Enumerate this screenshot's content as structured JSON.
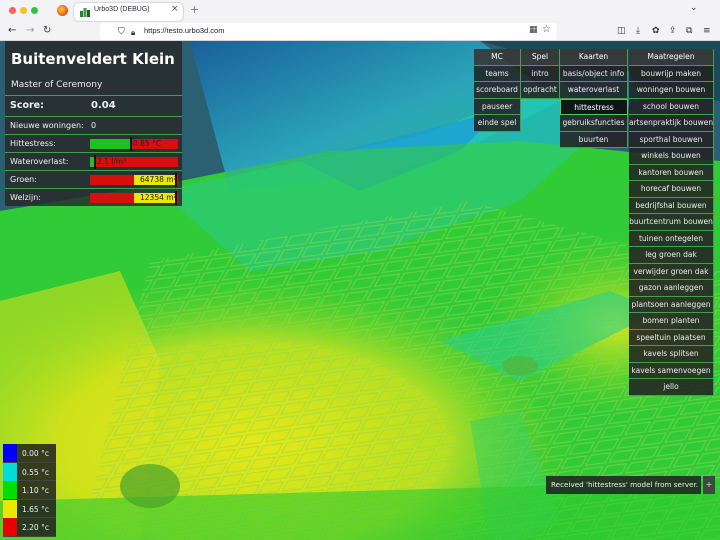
{
  "browser": {
    "tab_title": "Urbo3D (DEBUG)",
    "url": "https://testo.urbo3d.com"
  },
  "info_panel": {
    "title": "Buitenveldert Klein",
    "subtitle": "Master of Ceremony",
    "score_label": "Score:",
    "score_value": "0.04",
    "new_homes_label": "Nieuwe woningen:",
    "new_homes_value": "0",
    "heat_label": "Hittestress:",
    "heat_text": "0.85 °C",
    "heat_fraction": 0.45,
    "flood_label": "Wateroverlast:",
    "flood_text": "2.1 l/m²",
    "flood_fraction": 0.05,
    "green_label": "Groen:",
    "green_text": "64738 m²",
    "green_fraction": 0.99,
    "wellbeing_label": "Welzijn:",
    "wellbeing_text": "12354 m²",
    "wellbeing_fraction": 0.99
  },
  "menu": {
    "mc": {
      "header": "MC",
      "items": [
        "teams",
        "scoreboard",
        "pauseer",
        "einde spel"
      ]
    },
    "spel": {
      "header": "Spel",
      "items": [
        "intro",
        "opdracht"
      ]
    },
    "kaarten": {
      "header": "Kaarten",
      "items": [
        "basis/object info",
        "wateroverlast",
        "hittestress",
        "gebruiksfuncties",
        "buurten"
      ],
      "active": "hittestress"
    },
    "maatregelen": {
      "header": "Maatregelen",
      "items": [
        "bouwrijp maken",
        "woningen bouwen",
        "school bouwen",
        "artsenpraktijk bouwen",
        "sporthal bouwen",
        "winkels bouwen",
        "kantoren bouwen",
        "horecaf bouwen",
        "bedrijfshal bouwen",
        "buurtcentrum bouwen",
        "tuinen ontegelen",
        "leg groen dak",
        "verwijder groen dak",
        "gazon aanleggen",
        "plantsoen aanleggen",
        "bomen planten",
        "speeltuin plaatsen",
        "kavels splitsen",
        "kavels samenvoegen",
        "jello"
      ]
    }
  },
  "legend": [
    {
      "label": "0.00 °c",
      "color": "#0000ff"
    },
    {
      "label": "0.55 °c",
      "color": "#00dcdc"
    },
    {
      "label": "1.10 °c",
      "color": "#00e000"
    },
    {
      "label": "1.65 °c",
      "color": "#e8e800"
    },
    {
      "label": "2.20 °c",
      "color": "#e80000"
    }
  ],
  "toast": {
    "text": "Received 'hittestress' model from server.",
    "button": "+"
  },
  "colors": {
    "active_border": "#4ad05a",
    "panel_border": "#3fa24a",
    "bar_red": "#d80f0f",
    "bar_green": "#1ec21e",
    "bar_yellow": "#e8e800"
  }
}
